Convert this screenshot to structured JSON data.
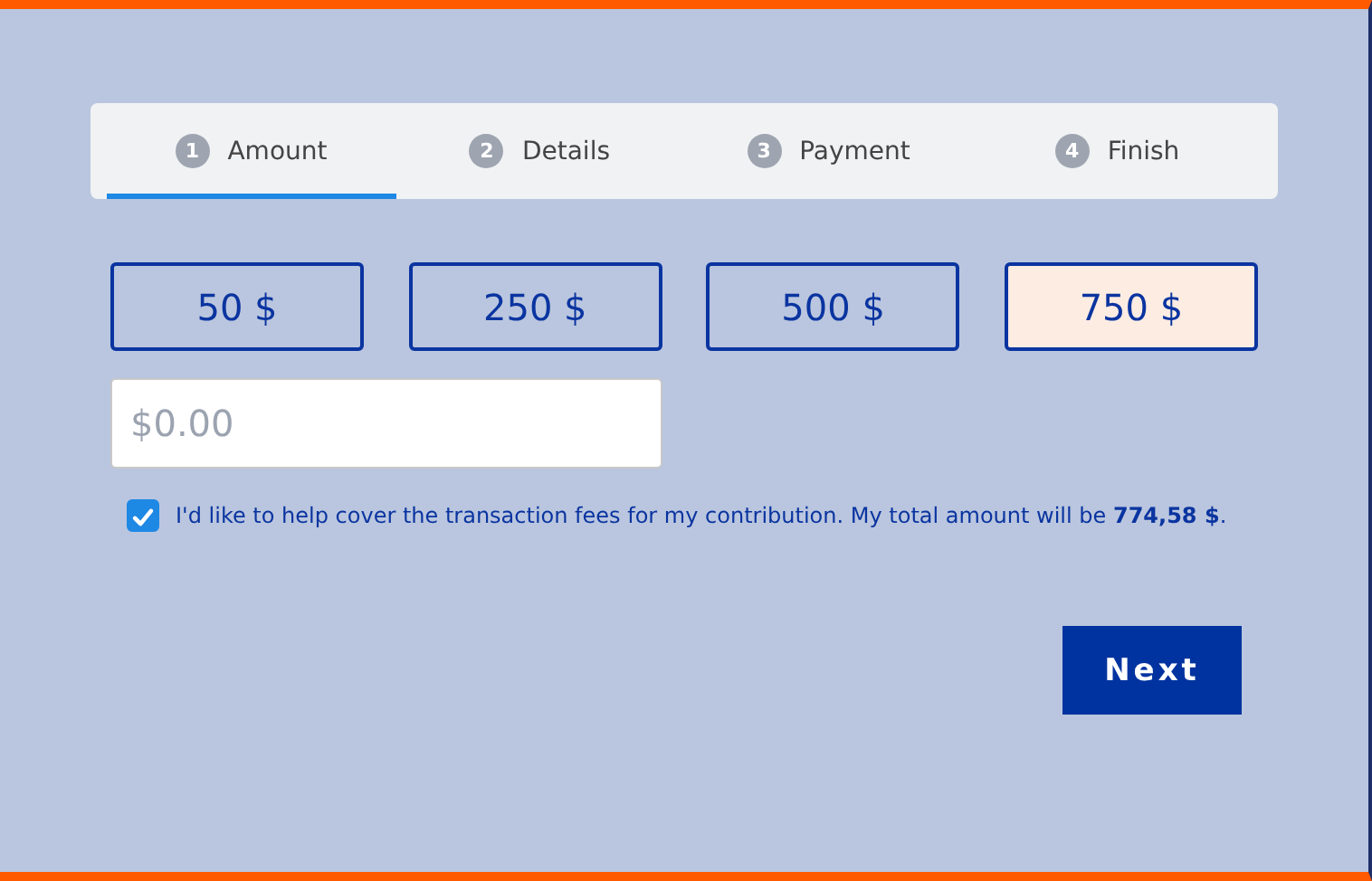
{
  "steps": [
    {
      "number": "1",
      "label": "Amount",
      "selected": true
    },
    {
      "number": "2",
      "label": "Details",
      "selected": false
    },
    {
      "number": "3",
      "label": "Payment",
      "selected": false
    },
    {
      "number": "4",
      "label": "Finish",
      "selected": false
    }
  ],
  "amounts": [
    {
      "label": "50 $",
      "selected": false
    },
    {
      "label": "250 $",
      "selected": false
    },
    {
      "label": "500 $",
      "selected": false
    },
    {
      "label": "750 $",
      "selected": true
    }
  ],
  "custom_amount": {
    "placeholder": "$0.00"
  },
  "cover_fees": {
    "checked": true,
    "text": "I'd like to help cover the transaction fees for my contribution. My total amount will be **774,58 $**."
  },
  "next_button": "Next"
}
